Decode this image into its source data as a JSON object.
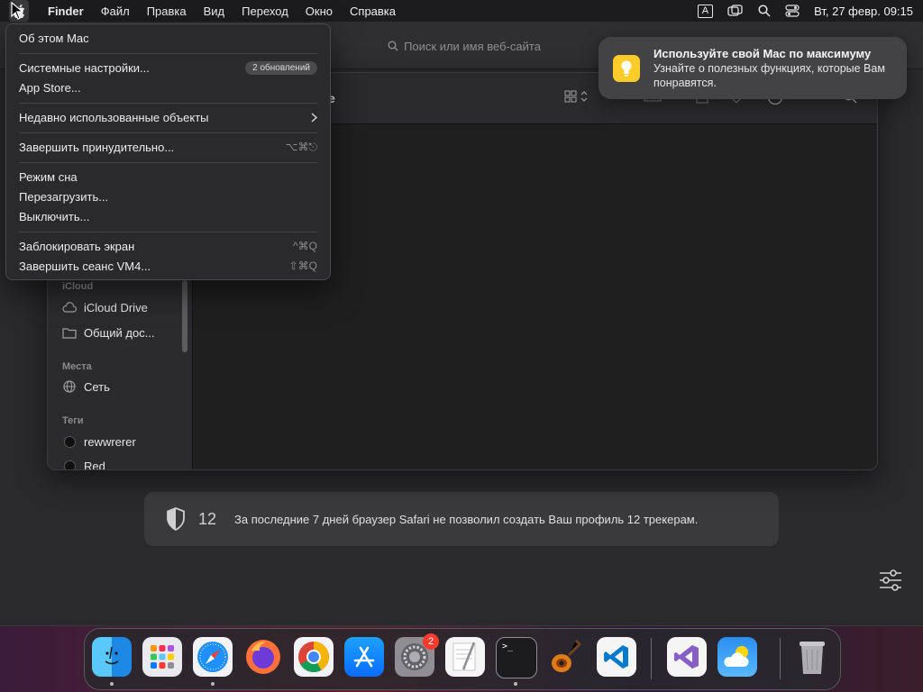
{
  "menubar": {
    "app_name": "Finder",
    "items": [
      "Файл",
      "Правка",
      "Вид",
      "Переход",
      "Окно",
      "Справка"
    ],
    "input_indicator": "A",
    "clock": "Вт, 27 февр.  09:15"
  },
  "apple_menu": {
    "about": "Об этом Mac",
    "settings": "Системные настройки...",
    "settings_badge": "2 обновлений",
    "app_store": "App Store...",
    "recent": "Недавно использованные объекты",
    "force_quit": "Завершить принудительно...",
    "force_quit_shortcut": "⌥⌘⎋",
    "sleep": "Режим сна",
    "restart": "Перезагрузить...",
    "shutdown": "Выключить...",
    "lock": "Заблокировать экран",
    "lock_shortcut": "^⌘Q",
    "logout": "Завершить сеанс VM4...",
    "logout_shortcut": "⇧⌘Q"
  },
  "notification": {
    "title": "Используйте свой Mac по максимуму",
    "body": "Узнайте о полезных функциях, которые Вам понравятся."
  },
  "safari": {
    "address_placeholder": "Поиск или имя веб-сайта",
    "tracker_count": "12",
    "tracker_message": "За последние 7 дней браузер Safari не позволил создать Ваш профиль 12 трекерам."
  },
  "finder": {
    "title_fragment": "e",
    "sidebar": {
      "icloud_header": "iCloud",
      "icloud_drive": "iCloud Drive",
      "shared": "Общий дос...",
      "places_header": "Места",
      "network": "Сеть",
      "tags_header": "Теги",
      "tag1": "rewwrerer",
      "tag2": "Red"
    }
  },
  "dock": {
    "apps": [
      "Finder",
      "Launchpad",
      "Safari",
      "Firefox",
      "Chrome",
      "App Store",
      "Системные настройки",
      "TextEdit",
      "Terminal",
      "GarageBand",
      "Visual Studio Code",
      "Visual Studio",
      "Погода",
      "Корзина"
    ],
    "settings_badge": "2",
    "terminal_prompt": ">_"
  },
  "colors": {
    "accent": "#0a84ff",
    "badge_red": "#ff3b30",
    "notif_icon": "#ffcc2a"
  }
}
